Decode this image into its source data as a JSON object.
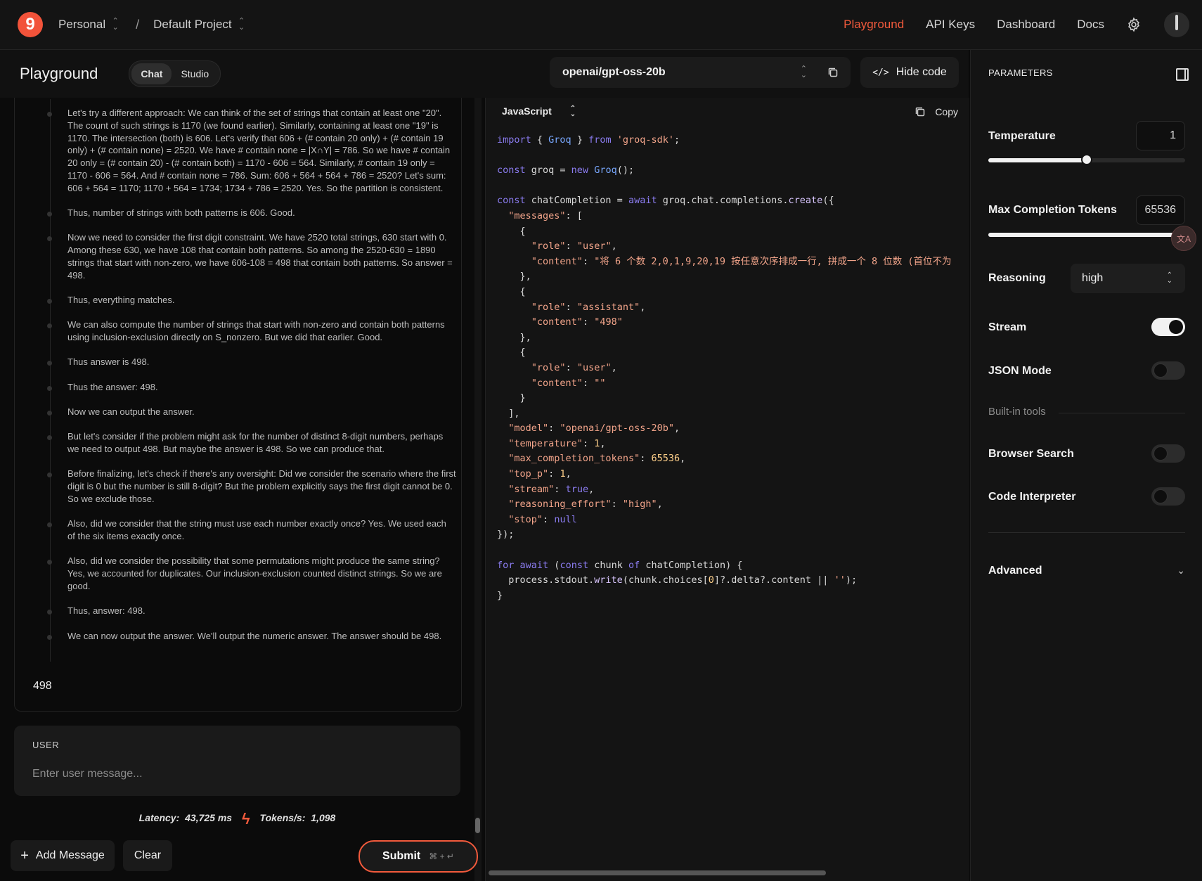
{
  "topbar": {
    "logo_letter": "9",
    "workspace": "Personal",
    "separator": "/",
    "project": "Default Project",
    "nav": [
      "Playground",
      "API Keys",
      "Dashboard",
      "Docs"
    ],
    "active_nav": "Playground",
    "accent_color": "#f25a3c"
  },
  "subbar": {
    "title": "Playground",
    "modes": [
      "Chat",
      "Studio"
    ],
    "active_mode": "Chat",
    "model": "openai/gpt-oss-20b",
    "hide_code_label": "Hide code"
  },
  "reasoning": [
    "Let's try a different approach: We can think of the set of strings that contain at least one \"20\". The count of such strings is 1170 (we found earlier). Similarly, containing at least one \"19\" is 1170. The intersection (both) is 606. Let's verify that 606 + (# contain 20 only) + (# contain 19 only) + (# contain none) = 2520. We have # contain none = |X∩Y| = 786. So we have # contain 20 only = (# contain 20) - (# contain both) = 1170 - 606 = 564. Similarly, # contain 19 only = 1170 - 606 = 564. And # contain none = 786. Sum: 606 + 564 + 564 + 786 = 2520? Let's sum: 606 + 564 = 1170; 1170 + 564 = 1734; 1734 + 786 = 2520. Yes. So the partition is consistent.",
    "Thus, number of strings with both patterns is 606. Good.",
    "Now we need to consider the first digit constraint. We have 2520 total strings, 630 start with 0. Among these 630, we have 108 that contain both patterns. So among the 2520-630 = 1890 strings that start with non-zero, we have 606-108 = 498 that contain both patterns. So answer = 498.",
    "Thus, everything matches.",
    "We can also compute the number of strings that start with non-zero and contain both patterns using inclusion-exclusion directly on S_nonzero. But we did that earlier. Good.",
    "Thus answer is 498.",
    "Thus the answer: 498.",
    "Now we can output the answer.",
    "But let's consider if the problem might ask for the number of distinct 8-digit numbers, perhaps we need to output 498. But maybe the answer is 498. So we can produce that.",
    "Before finalizing, let's check if there's any oversight: Did we consider the scenario where the first digit is 0 but the number is still 8-digit? But the problem explicitly says the first digit cannot be 0. So we exclude those.",
    "Also, did we consider that the string must use each number exactly once? Yes. We used each of the six items exactly once.",
    "Also, did we consider the possibility that some permutations might produce the same string? Yes, we accounted for duplicates. Our inclusion-exclusion counted distinct strings. So we are good.",
    "Thus, answer: 498.",
    "We can now output the answer. We'll output the numeric answer. The answer should be 498."
  ],
  "answer": "498",
  "user_box": {
    "label": "USER",
    "placeholder": "Enter user message..."
  },
  "stats": {
    "latency_label": "Latency:",
    "latency_value": "43,725 ms",
    "tokens_label": "Tokens/s:",
    "tokens_value": "1,098"
  },
  "actions": {
    "add_message": "Add Message",
    "clear": "Clear",
    "submit": "Submit",
    "submit_shortcut": "⌘ + ↵"
  },
  "code_panel": {
    "language": "JavaScript",
    "copy_label": "Copy",
    "user_content_truncated": "\"将 6 个数 2,0,1,9,20,19 按任意次序排成一行, 拼成一个 8 位数 (首位不为"
  },
  "params": {
    "header": "PARAMETERS",
    "temperature_label": "Temperature",
    "temperature_value": "1",
    "temperature_fraction": 0.5,
    "max_tokens_label": "Max Completion Tokens",
    "max_tokens_value": "65536",
    "max_tokens_fraction": 1.0,
    "reasoning_label": "Reasoning",
    "reasoning_value": "high",
    "stream_label": "Stream",
    "stream_on": true,
    "json_mode_label": "JSON Mode",
    "json_mode_on": false,
    "builtin_tools_label": "Built-in tools",
    "browser_search_label": "Browser Search",
    "browser_search_on": false,
    "code_interpreter_label": "Code Interpreter",
    "code_interpreter_on": false,
    "advanced_label": "Advanced"
  }
}
